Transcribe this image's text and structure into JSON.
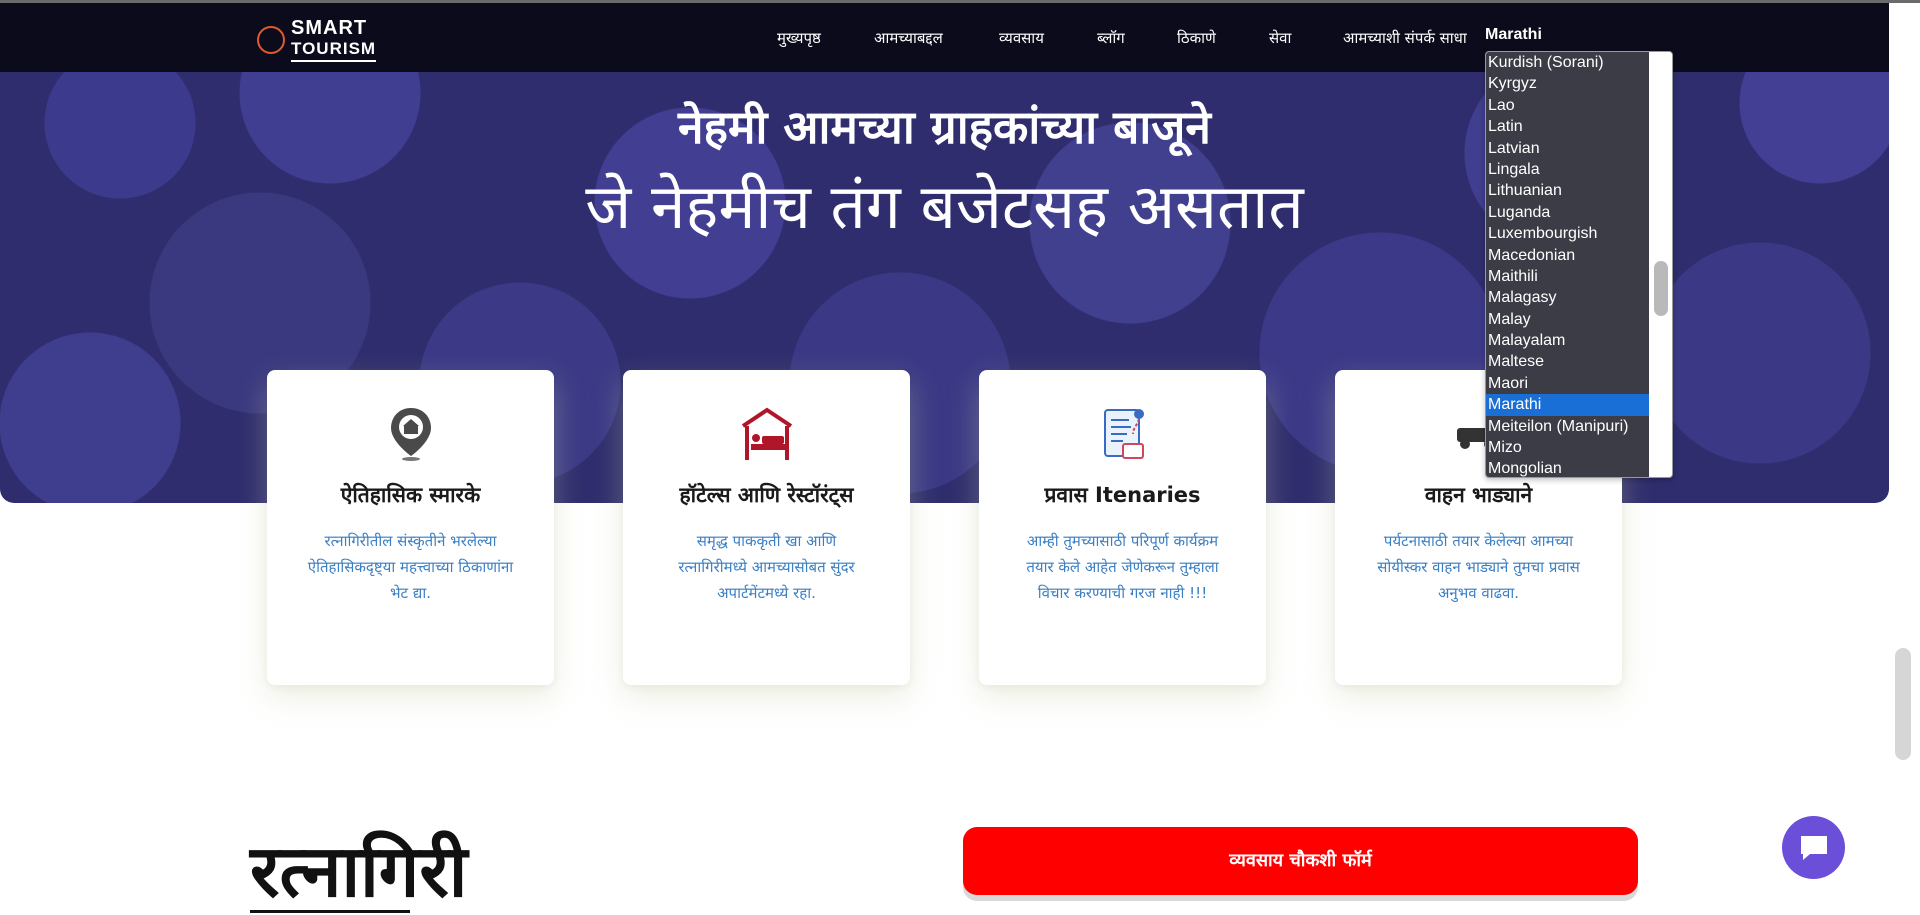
{
  "logo": {
    "line1": "SMART",
    "line2": "TOURISM"
  },
  "nav": {
    "items": [
      {
        "label": "मुख्यपृष्ठ"
      },
      {
        "label": "आमच्याबद्दल"
      },
      {
        "label": "व्यवसाय"
      },
      {
        "label": "ब्लॉग"
      },
      {
        "label": "ठिकाणे"
      },
      {
        "label": "सेवा"
      },
      {
        "label": "आमच्याशी संपर्क साधा"
      }
    ],
    "current_language": "Marathi"
  },
  "hero": {
    "title": "नेहमी आमच्या ग्राहकांच्या बाजूने",
    "subtitle": "जे नेहमीच तंग बजेटसह असतात"
  },
  "cards": [
    {
      "icon": "monument-pin-icon",
      "title": "ऐतिहासिक स्मारके",
      "desc": "रत्नागिरीतील संस्कृतीने भरलेल्या ऐतिहासिकदृष्ट्या महत्त्वाच्या ठिकाणांना भेट द्या."
    },
    {
      "icon": "hotel-bed-icon",
      "title": "हॉटेल्स आणि रेस्टॉरंट्स",
      "desc": "समृद्ध पाककृती खा आणि रत्नागिरीमध्ये आमच्यासोबत सुंदर अपार्टमेंटमध्ये रहा."
    },
    {
      "icon": "itinerary-document-icon",
      "title": "प्रवास Itenaries",
      "desc": "आम्ही तुमच्यासाठी परिपूर्ण कार्यक्रम तयार केले आहेत जेणेकरून तुम्हाला विचार करण्याची गरज नाही !!!"
    },
    {
      "icon": "vehicle-rental-icon",
      "title": "वाहन भाड्याने",
      "desc": "पर्यटनासाठी तयार केलेल्या आमच्या सोयीस्कर वाहन भाड्याने तुमचा प्रवास अनुभव वाढवा."
    }
  ],
  "language_options": [
    "Kurdish (Sorani)",
    "Kyrgyz",
    "Lao",
    "Latin",
    "Latvian",
    "Lingala",
    "Lithuanian",
    "Luganda",
    "Luxembourgish",
    "Macedonian",
    "Maithili",
    "Malagasy",
    "Malay",
    "Malayalam",
    "Maltese",
    "Maori",
    "Marathi",
    "Meiteilon (Manipuri)",
    "Mizo",
    "Mongolian"
  ],
  "selected_language": "Marathi",
  "section": {
    "heading": "रत्नागिरी",
    "enquiry_button": "व्यवसाय चौकशी फॉर्म"
  },
  "colors": {
    "navbar": "#0b0b1c",
    "hero_bg": "#2f2d6d",
    "card_text": "#3a7fc4",
    "enquiry_button": "#ff0000",
    "chat_button": "#6b4fd8",
    "selected_option": "#1a6fd6",
    "dropdown_bg": "#3b3c45"
  }
}
